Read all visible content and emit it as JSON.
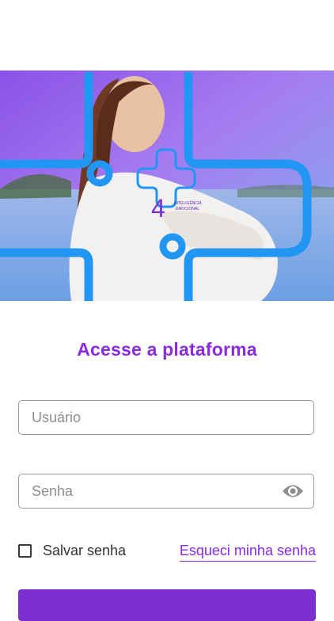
{
  "hero": {
    "logo_number": "4",
    "logo_text_line1": "INTELIGÊNCIA",
    "logo_text_line2": "EMOCIONAL"
  },
  "login": {
    "title": "Acesse a plataforma",
    "username_placeholder": "Usuário",
    "password_placeholder": "Senha",
    "remember_label": "Salvar senha",
    "forgot_label": "Esqueci minha senha"
  },
  "colors": {
    "accent": "#8a2be2",
    "hero_gradient_top": "#7e5bef",
    "hero_gradient_bottom": "#6aa7e8",
    "cross_stroke": "#2196f3"
  }
}
